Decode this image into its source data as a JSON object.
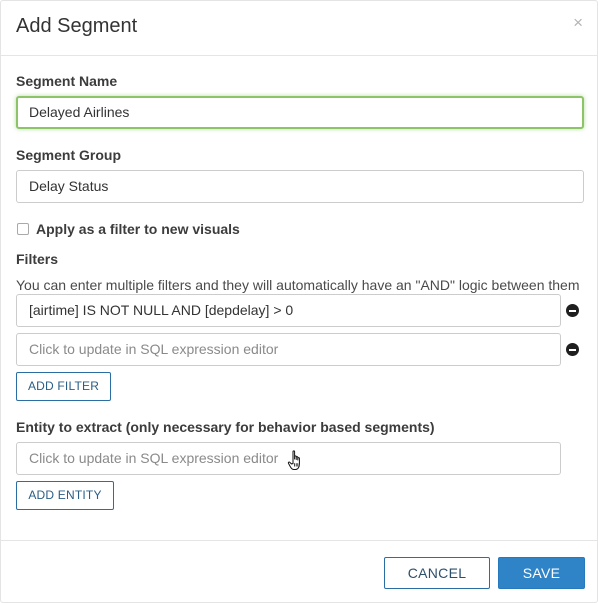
{
  "modal": {
    "title": "Add Segment",
    "close_symbol": "×"
  },
  "segment_name": {
    "label": "Segment Name",
    "value": "Delayed Airlines"
  },
  "segment_group": {
    "label": "Segment Group",
    "value": "Delay Status"
  },
  "apply_filter": {
    "label": "Apply as a filter to new visuals",
    "checked": false
  },
  "filters": {
    "label": "Filters",
    "help_text": "You can enter multiple filters and they will automatically have an \"AND\" logic between them",
    "items": [
      {
        "value": "[airtime] IS NOT NULL AND [depdelay] > 0"
      },
      {
        "placeholder": "Click to update in SQL expression editor"
      }
    ],
    "add_label": "ADD FILTER"
  },
  "entity": {
    "label": "Entity to extract (only necessary for behavior based segments)",
    "placeholder": "Click to update in SQL expression editor",
    "add_label": "ADD ENTITY"
  },
  "footer": {
    "cancel_label": "CANCEL",
    "save_label": "SAVE"
  },
  "colors": {
    "primary": "#2f83c7",
    "focus_border": "#8cc467"
  },
  "icons": [
    "close-icon",
    "remove-icon",
    "hand-cursor-icon"
  ]
}
